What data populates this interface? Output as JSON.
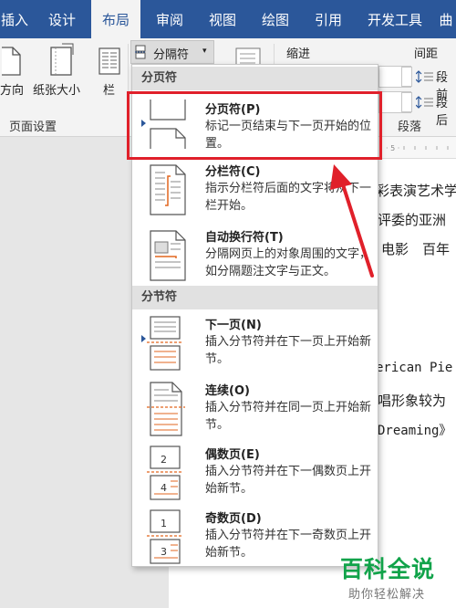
{
  "tabs": [
    "插入",
    "设计",
    "布局",
    "审阅",
    "视图",
    "绘图",
    "引用",
    "开发工具",
    "曲"
  ],
  "active_tab": "布局",
  "ribbon": {
    "orientation_label": "纸张方向",
    "orientation_label_visible": "方向",
    "size_label": "纸张大小",
    "columns_label": "栏",
    "page_setup_group": "页面设置",
    "breaks_button": "分隔符",
    "indent_label": "缩进",
    "spacing_label": "间距",
    "spacing_before": "段前",
    "spacing_after": "段后",
    "paragraph_group": "段落"
  },
  "dropdown": {
    "page_breaks_header": "分页符",
    "section_breaks_header": "分节符",
    "items": [
      {
        "title": "分页符(P)",
        "desc": "标记一页结束与下一页开始的位置。"
      },
      {
        "title": "分栏符(C)",
        "desc": "指示分栏符后面的文字将从下一栏开始。"
      },
      {
        "title": "自动换行符(T)",
        "desc": "分隔网页上的对象周围的文字，如分隔题注文字与正文。"
      },
      {
        "title": "下一页(N)",
        "desc": "插入分节符并在下一页上开始新节。"
      },
      {
        "title": "连续(O)",
        "desc": "插入分节符并在同一页上开始新节。"
      },
      {
        "title": "偶数页(E)",
        "desc": "插入分节符并在下一偶数页上开始新节。"
      },
      {
        "title": "奇数页(D)",
        "desc": "插入分节符并在下一奇数页上开始新节。"
      }
    ]
  },
  "document": {
    "lines": [
      "彩表演艺术学",
      "评委的亚洲",
      "电影　百年",
      "erican Pie",
      "唱形象较为",
      "Dreaming》"
    ]
  },
  "icons": {
    "orientation": "page-orientation-icon",
    "size": "paper-size-icon",
    "columns": "columns-icon",
    "breaks": "breaks-icon"
  },
  "colors": {
    "ribbon_blue": "#2b579a",
    "highlight_red": "#e0202a",
    "watermark_green": "#11a34a"
  },
  "watermark": {
    "main": "百科全说",
    "sub": "助你轻松解决"
  }
}
